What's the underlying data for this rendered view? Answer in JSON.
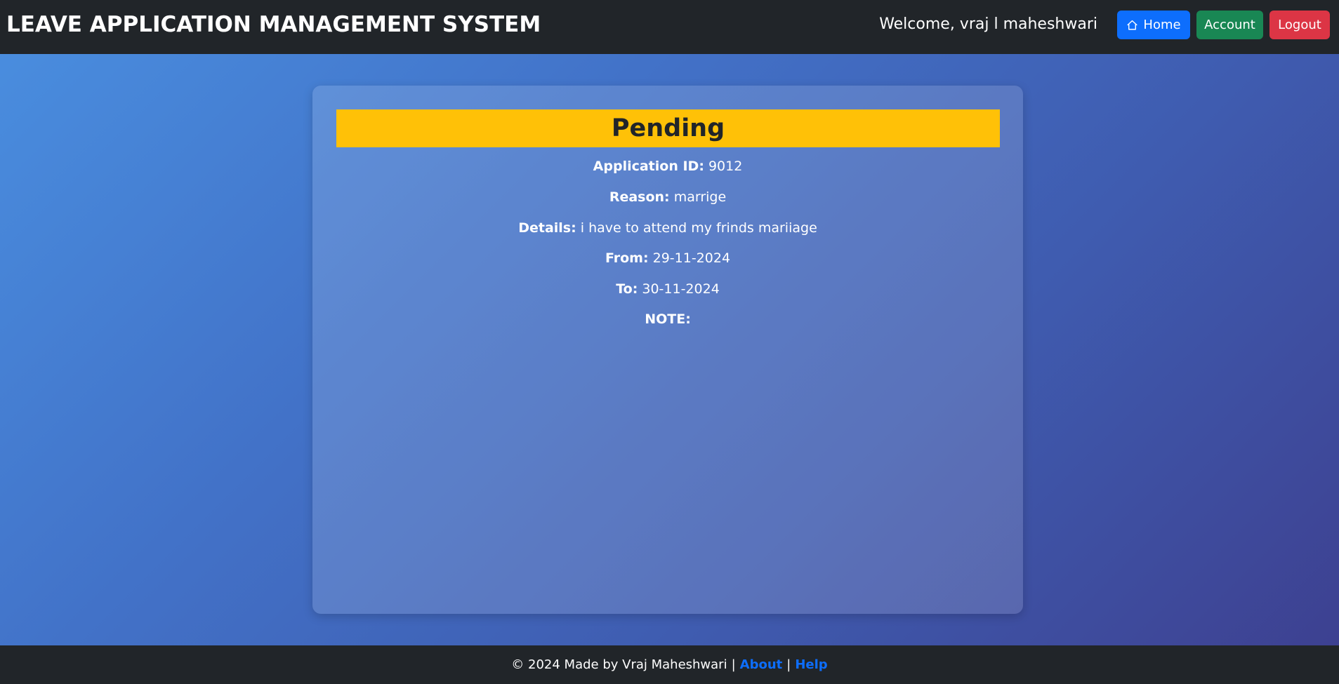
{
  "navbar": {
    "brand": "LEAVE APPLICATION MANAGEMENT SYSTEM",
    "welcome": "Welcome, vraj l maheshwari",
    "buttons": {
      "home": "Home",
      "account": "Account",
      "logout": "Logout"
    }
  },
  "application": {
    "status": "Pending",
    "fields": [
      {
        "label": "Application ID:",
        "value": "9012"
      },
      {
        "label": "Reason:",
        "value": "marrige"
      },
      {
        "label": "Details:",
        "value": "i have to attend my frinds mariiage"
      },
      {
        "label": "From:",
        "value": "29-11-2024"
      },
      {
        "label": "To:",
        "value": "30-11-2024"
      },
      {
        "label": "NOTE:",
        "value": ""
      }
    ]
  },
  "footer": {
    "copyright": "© 2024 Made by Vraj Maheshwari",
    "separator": "|",
    "about": "About",
    "help": "Help"
  },
  "colors": {
    "navbar_bg": "#212529",
    "home_button": "#0d6efd",
    "account_button": "#198754",
    "logout_button": "#dc3545",
    "status_pending": "#ffc107",
    "link": "#0d6efd"
  },
  "icons": {
    "home": "home-icon"
  }
}
